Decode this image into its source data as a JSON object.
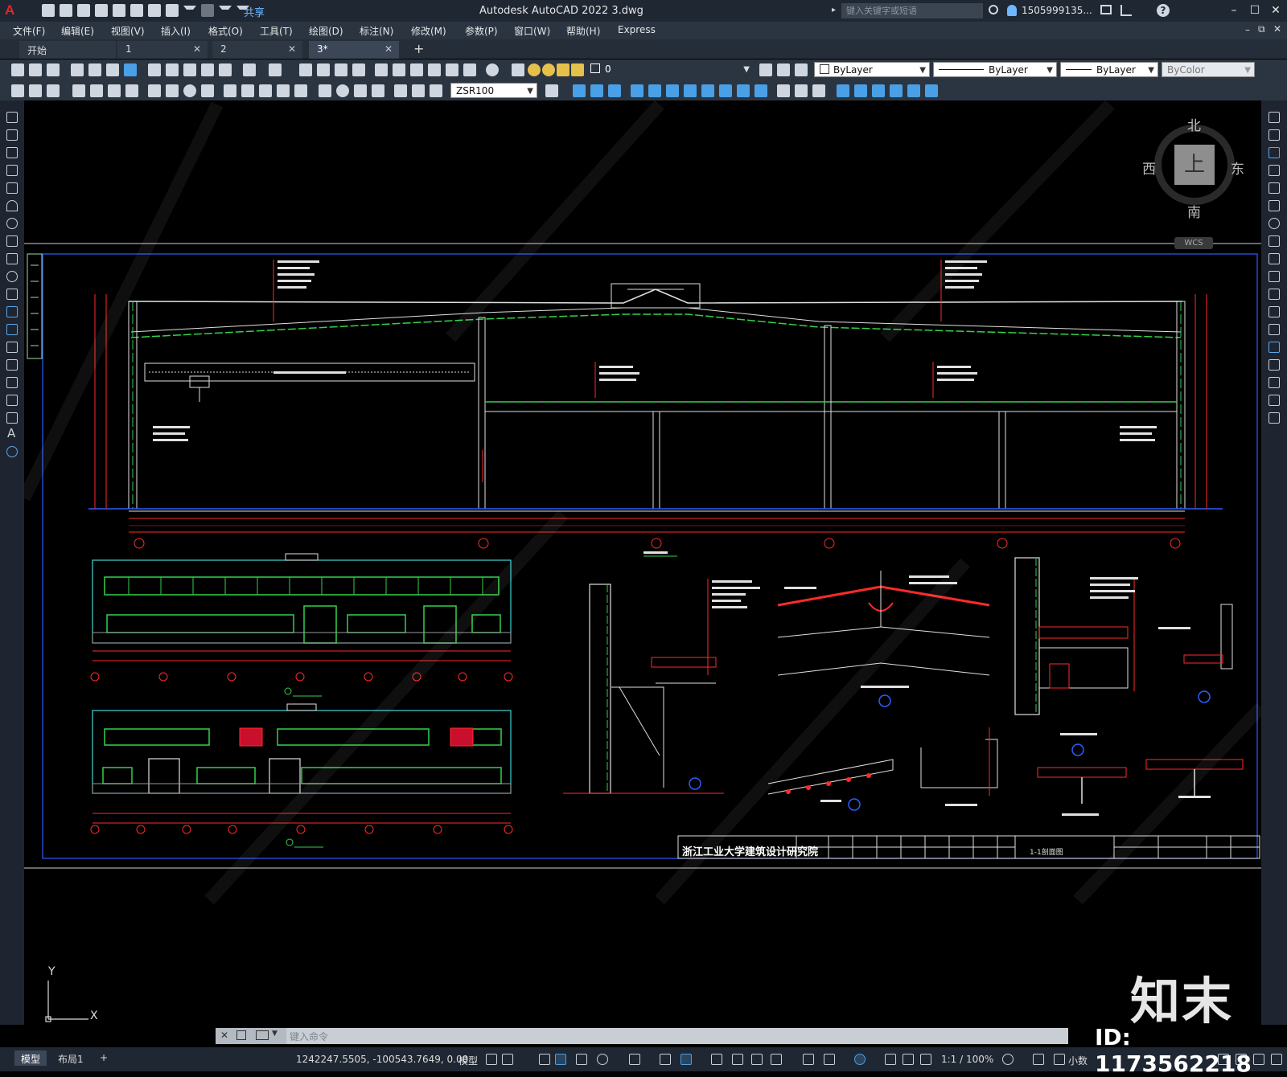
{
  "app": {
    "logo": "A",
    "share_label": "共享",
    "title": "Autodesk AutoCAD 2022    3.dwg",
    "search_placeholder": "键入关键字或短语",
    "user": "1505999135...",
    "help": "?"
  },
  "menu": [
    "文件(F)",
    "编辑(E)",
    "视图(V)",
    "插入(I)",
    "格式(O)",
    "工具(T)",
    "绘图(D)",
    "标注(N)",
    "修改(M)",
    "参数(P)",
    "窗口(W)",
    "帮助(H)",
    "Express"
  ],
  "tabs": [
    {
      "label": "开始",
      "closable": false,
      "active": false
    },
    {
      "label": "1",
      "closable": true,
      "active": false
    },
    {
      "label": "2",
      "closable": true,
      "active": false
    },
    {
      "label": "3*",
      "closable": true,
      "active": true
    }
  ],
  "properties": {
    "layer": "0",
    "color": "ByLayer",
    "linetype": "ByLayer",
    "lineweight": "ByLayer",
    "plotstyle": "ByColor",
    "dimstyle": "ZSR100"
  },
  "viewcube": {
    "north": "北",
    "south": "南",
    "east": "东",
    "west": "西",
    "face": "上",
    "wcs": "WCS"
  },
  "drawing": {
    "title_block_org": "浙江工业大学建筑设计研究院",
    "section_label": "1-1剖面图",
    "ucs_x": "X",
    "ucs_y": "Y"
  },
  "command": {
    "placeholder": "键入命令"
  },
  "layout_tabs": [
    {
      "label": "模型",
      "active": true
    },
    {
      "label": "布局1",
      "active": false
    },
    {
      "label": "+",
      "active": false
    }
  ],
  "status": {
    "coords": "1242247.5505, -100543.7649, 0.00...",
    "model": "模型",
    "scale": "1:1 / 100%",
    "units": "小数"
  },
  "watermark": {
    "brand": "知末",
    "id": "ID: 1173562218"
  },
  "colors": {
    "accent": "#4aa0e6",
    "canvas": "#000000",
    "chrome": "#2b3542",
    "drawing_red": "#ff2a2a",
    "drawing_green": "#33d14a",
    "drawing_cyan": "#3fd6d6"
  }
}
